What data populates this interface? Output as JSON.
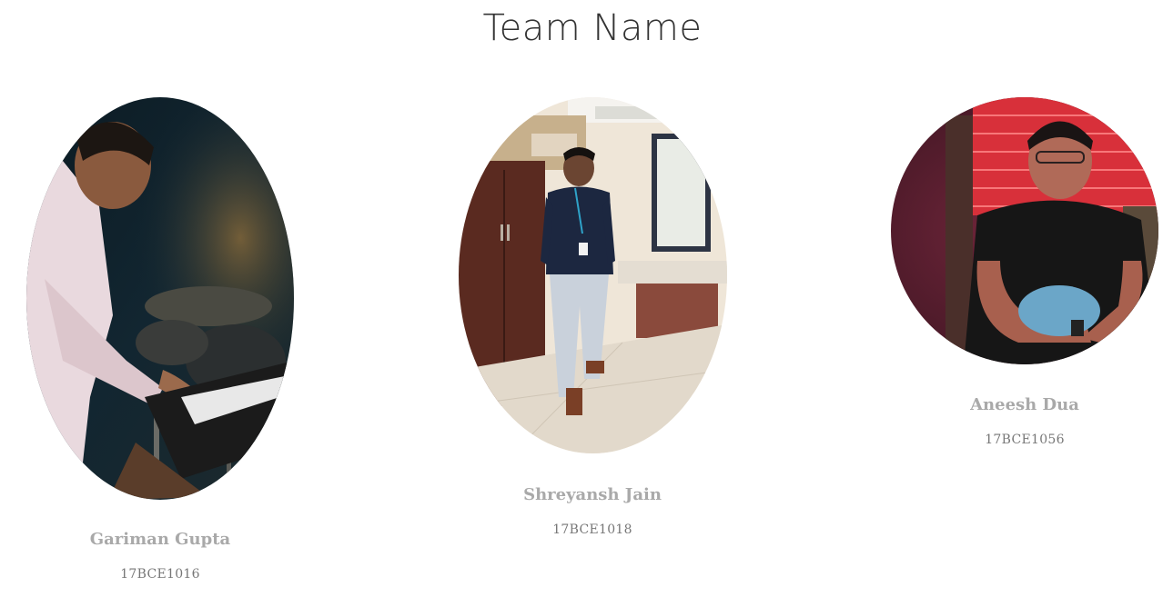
{
  "page": {
    "title": "Team Name"
  },
  "members": [
    {
      "name": "Gariman Gupta",
      "reg_no": "17BCE1016",
      "photo": "person-playing-keyboard-photo"
    },
    {
      "name": "Shreyansh Jain",
      "reg_no": "17BCE1018",
      "photo": "person-standing-in-room-photo"
    },
    {
      "name": "Aneesh Dua",
      "reg_no": "17BCE1056",
      "photo": "person-sitting-red-lights-photo"
    }
  ]
}
